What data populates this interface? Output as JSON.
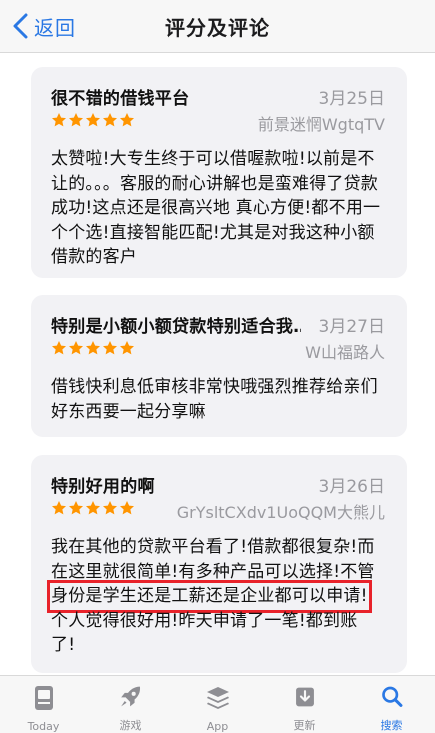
{
  "nav": {
    "back_label": "返回",
    "title": "评分及评论"
  },
  "colors": {
    "accent": "#2a78e4",
    "star": "#ff9500",
    "card_bg": "#f2f2f5",
    "highlight": "#e8222a"
  },
  "reviews": [
    {
      "title": "很不错的借钱平台",
      "date": "3月25日",
      "rating": 5,
      "author": "前景迷惘WgtqTV",
      "body": "太赞啦!大专生终于可以借喔款啦!以前是不让的。。。客服的耐心讲解也是蛮难得了贷款成功!这点还是很高兴地 真心方便!都不用一个个选!直接智能匹配!尤其是对我这种小额借款的客户"
    },
    {
      "title": "特别是小额小额贷款特别适合我…",
      "date": "3月27日",
      "rating": 5,
      "author": "W山福路人",
      "body": "借钱快利息低审核非常快哦强烈推荐给亲们好东西要一起分享嘛"
    },
    {
      "title": "特别好用的啊",
      "date": "3月26日",
      "rating": 5,
      "author": "GrYsltCXdv1UoQQM大熊儿",
      "body_lines": [
        "我在其他的贷款平台看了!借款都很复杂!而",
        "在这里就很简单!有多种产品可以选择!不管",
        "身份是学生还是工薪还是企业都可以申请!",
        "个人觉得很好用!昨天申请了一笔!都到账",
        "了!"
      ]
    }
  ],
  "tabbar": {
    "tabs": [
      {
        "label": "Today",
        "icon": "today-icon",
        "active": false
      },
      {
        "label": "游戏",
        "icon": "rocket-icon",
        "active": false
      },
      {
        "label": "App",
        "icon": "layers-icon",
        "active": false
      },
      {
        "label": "更新",
        "icon": "download-icon",
        "active": false
      },
      {
        "label": "搜索",
        "icon": "search-icon",
        "active": true
      }
    ]
  }
}
